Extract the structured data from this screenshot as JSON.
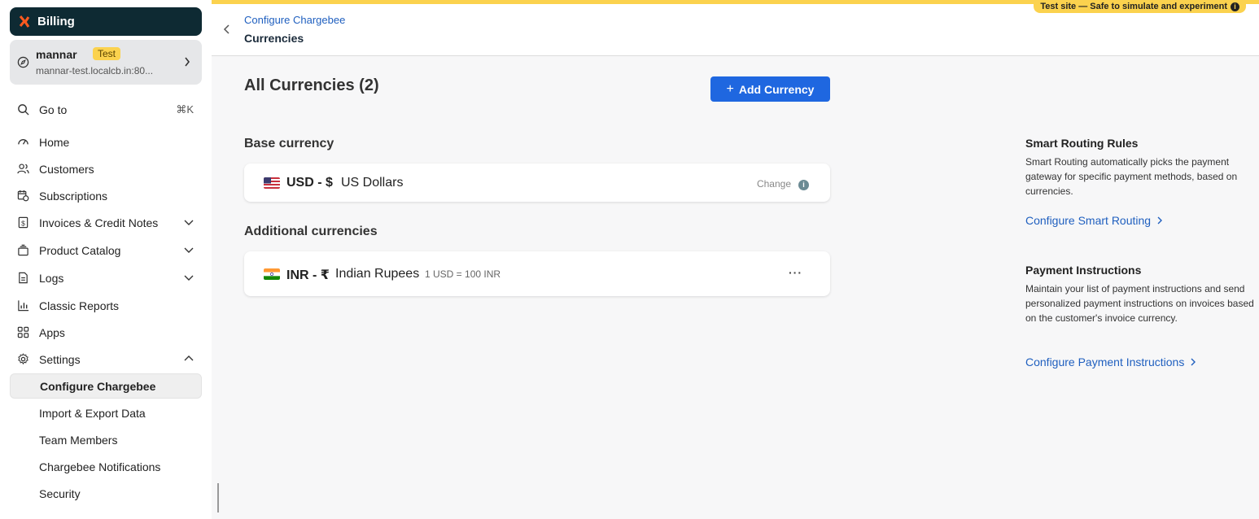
{
  "sidebar": {
    "brand": "Billing",
    "site": {
      "name": "mannar",
      "badge": "Test",
      "url": "mannar-test.localcb.in:80..."
    },
    "goto": {
      "label": "Go to",
      "shortcut": "⌘K"
    },
    "items": [
      {
        "label": "Home",
        "icon": "home-icon"
      },
      {
        "label": "Customers",
        "icon": "customers-icon"
      },
      {
        "label": "Subscriptions",
        "icon": "subscriptions-icon"
      },
      {
        "label": "Invoices & Credit Notes",
        "icon": "invoice-icon"
      },
      {
        "label": "Product Catalog",
        "icon": "catalog-icon"
      },
      {
        "label": "Logs",
        "icon": "logs-icon"
      },
      {
        "label": "Classic Reports",
        "icon": "reports-icon"
      },
      {
        "label": "Apps",
        "icon": "apps-icon"
      },
      {
        "label": "Settings",
        "icon": "settings-icon"
      }
    ],
    "settings_sub": [
      {
        "label": "Configure Chargebee",
        "active": true
      },
      {
        "label": "Import & Export Data"
      },
      {
        "label": "Team Members"
      },
      {
        "label": "Chargebee Notifications"
      },
      {
        "label": "Security"
      }
    ]
  },
  "topbar": {
    "test_notice": "Test site — Safe to simulate and experiment",
    "breadcrumb": "Configure Chargebee",
    "title": "Currencies",
    "accent_color": "#fbd24e"
  },
  "main": {
    "heading": "All Currencies (2)",
    "add_button": "Add Currency",
    "base_section": "Base currency",
    "base_currency": {
      "code": "USD - $",
      "name": "US Dollars",
      "action": "Change"
    },
    "additional_section": "Additional currencies",
    "additional": [
      {
        "code": "INR - ₹",
        "name": "Indian Rupees",
        "rate": "1 USD = 100 INR"
      }
    ]
  },
  "right_panel": {
    "smart_routing": {
      "title": "Smart Routing Rules",
      "text": "Smart Routing automatically picks the payment gateway for specific payment methods, based on currencies.",
      "link": "Configure Smart Routing"
    },
    "payment_instructions": {
      "title": "Payment Instructions",
      "text": "Maintain your list of payment instructions and send personalized payment instructions on invoices based on the customer's invoice currency.",
      "link": "Configure Payment Instructions"
    }
  }
}
